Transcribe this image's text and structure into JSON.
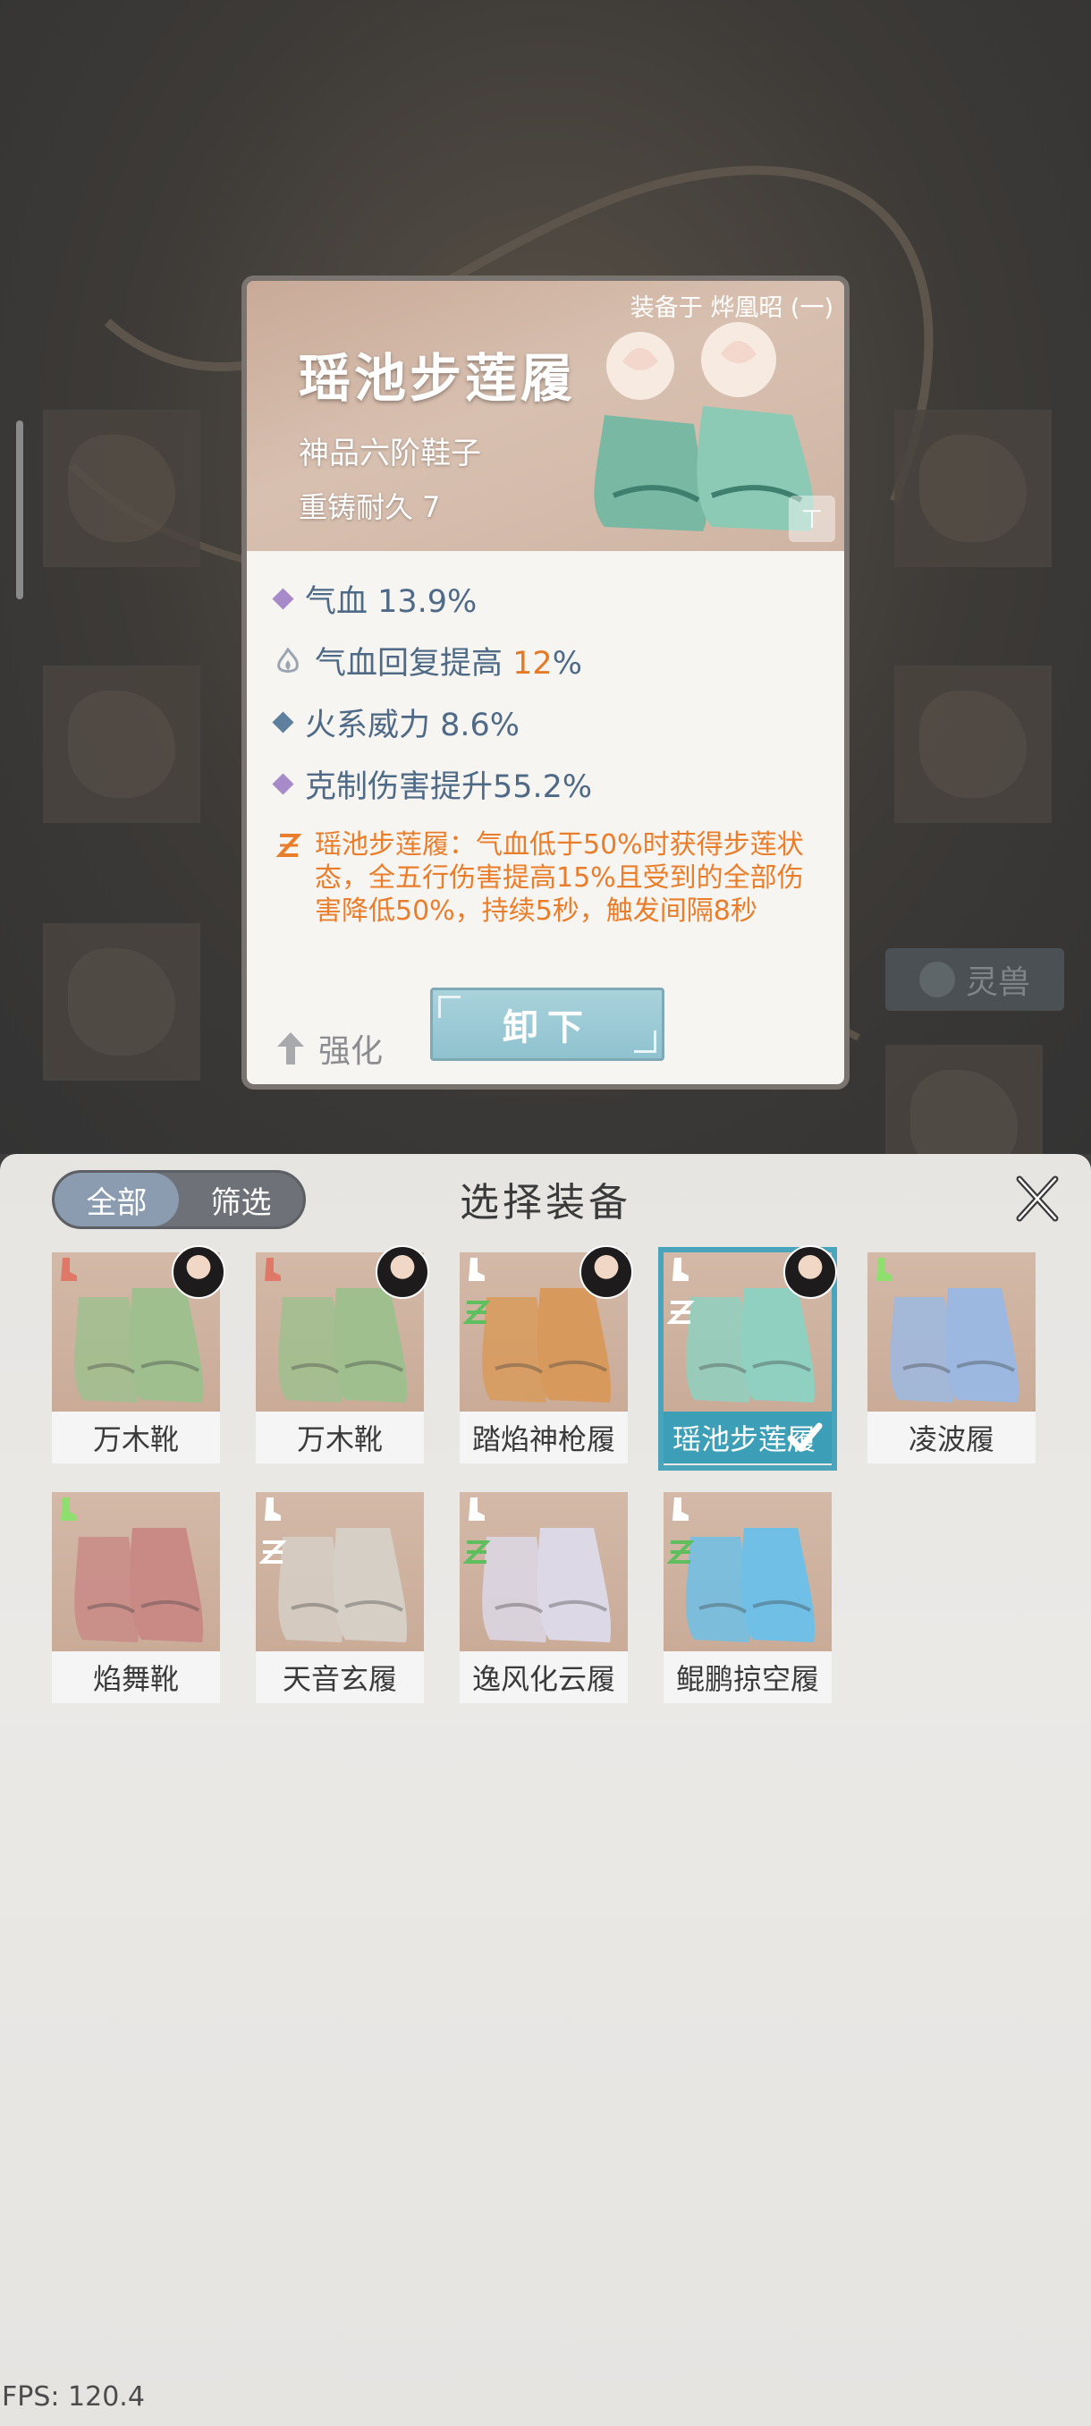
{
  "detail": {
    "equipped_on": "装备于 烨凰昭 (一)",
    "name": "瑶池步莲履",
    "tier": "神品六阶鞋子",
    "durability": "重铸耐久 7",
    "stats": [
      {
        "icon": "purple-diamond-icon",
        "color": "#a78ac9",
        "text": "气血 13.9%",
        "highlight": ""
      },
      {
        "icon": "flame-icon",
        "color": "#9aa5b1",
        "text": "气血回复提高 ",
        "highlight": "12",
        "suffix": "%"
      },
      {
        "icon": "blue-diamond-icon",
        "color": "#5e7f9e",
        "text": "火系威力 8.6%",
        "highlight": ""
      },
      {
        "icon": "purple-diamond-icon",
        "color": "#a78ac9",
        "text": "克制伤害提升55.2%",
        "highlight": ""
      }
    ],
    "skill_text": "瑶池步莲履：气血低于50%时获得步莲状态，全五行伤害提高15%且受到的全部伤害降低50%，持续5秒，触发间隔8秒",
    "enhance_label": "强化",
    "unequip_label": "卸下"
  },
  "background": {
    "lingshou_label": "灵兽"
  },
  "panel": {
    "tabs": [
      {
        "label": "全部",
        "active": true
      },
      {
        "label": "筛选",
        "active": false
      }
    ],
    "title": "选择装备",
    "items": [
      {
        "name": "万木靴",
        "color": "#9fbf8e",
        "avatar": true,
        "type_color": "#e07868",
        "elem": ""
      },
      {
        "name": "万木靴",
        "color": "#9fbf8e",
        "avatar": true,
        "type_color": "#e07868",
        "elem": ""
      },
      {
        "name": "踏焰神枪履",
        "color": "#d89a5c",
        "avatar": true,
        "type_color": "#ffffff",
        "elem": "#5fbf5f"
      },
      {
        "name": "瑶池步莲履",
        "color": "#8fd0c0",
        "avatar": true,
        "type_color": "#ffffff",
        "elem": "#ffffff",
        "selected": true
      },
      {
        "name": "凌波履",
        "color": "#9cb8e0",
        "avatar": false,
        "type_color": "#8fdf6f",
        "elem": ""
      },
      {
        "name": "焰舞靴",
        "color": "#c98a86",
        "avatar": false,
        "type_color": "#8fdf6f",
        "elem": ""
      },
      {
        "name": "天音玄履",
        "color": "#d6cfc6",
        "avatar": false,
        "type_color": "#ffffff",
        "elem": "#ffffff"
      },
      {
        "name": "逸风化云履",
        "color": "#dcd8e6",
        "avatar": false,
        "type_color": "#ffffff",
        "elem": "#5fbf5f"
      },
      {
        "name": "鲲鹏掠空履",
        "color": "#6fbfe6",
        "avatar": false,
        "type_color": "#ffffff",
        "elem": "#5fbf5f"
      }
    ]
  },
  "fps": "FPS: 120.4"
}
